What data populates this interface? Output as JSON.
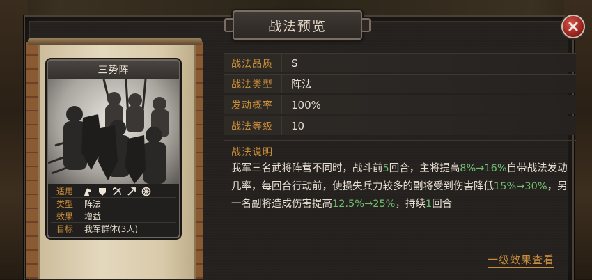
{
  "dialog": {
    "title": "战法预览"
  },
  "card": {
    "title": "三势阵",
    "info": [
      {
        "label": "适用",
        "value": ""
      },
      {
        "label": "类型",
        "value": "阵法"
      },
      {
        "label": "效果",
        "value": "增益"
      },
      {
        "label": "目标",
        "value": "我军群体(3人)"
      }
    ],
    "role_icons": [
      "cavalry-icon",
      "shield-icon",
      "archer-icon",
      "spear-icon",
      "siege-icon"
    ]
  },
  "properties": [
    {
      "label": "战法品质",
      "value": "S"
    },
    {
      "label": "战法类型",
      "value": "阵法"
    },
    {
      "label": "发动概率",
      "value": "100%"
    },
    {
      "label": "战法等级",
      "value": "10"
    }
  ],
  "description": {
    "heading": "战法说明",
    "segments": [
      {
        "text": "我军三名武将阵营不同时，战斗前",
        "hl": false
      },
      {
        "text": "5",
        "hl": true
      },
      {
        "text": "回合，主将提高",
        "hl": false
      },
      {
        "text": "8%→16%",
        "hl": true
      },
      {
        "text": "自带战法发动几率，每回合行动前，使损失兵力较多的副将受到伤害降低",
        "hl": false
      },
      {
        "text": "15%→30%",
        "hl": true
      },
      {
        "text": "，另一名副将造成伤害提高",
        "hl": false
      },
      {
        "text": "12.5%→25%",
        "hl": true
      },
      {
        "text": "，持续",
        "hl": false
      },
      {
        "text": "1",
        "hl": true
      },
      {
        "text": "回合",
        "hl": false
      }
    ]
  },
  "footer": {
    "link_label": "一级效果查看"
  },
  "colors": {
    "label": "#c98d3a",
    "highlight": "#6fbf73",
    "text": "#e6ded2",
    "close": "#b8332b"
  }
}
